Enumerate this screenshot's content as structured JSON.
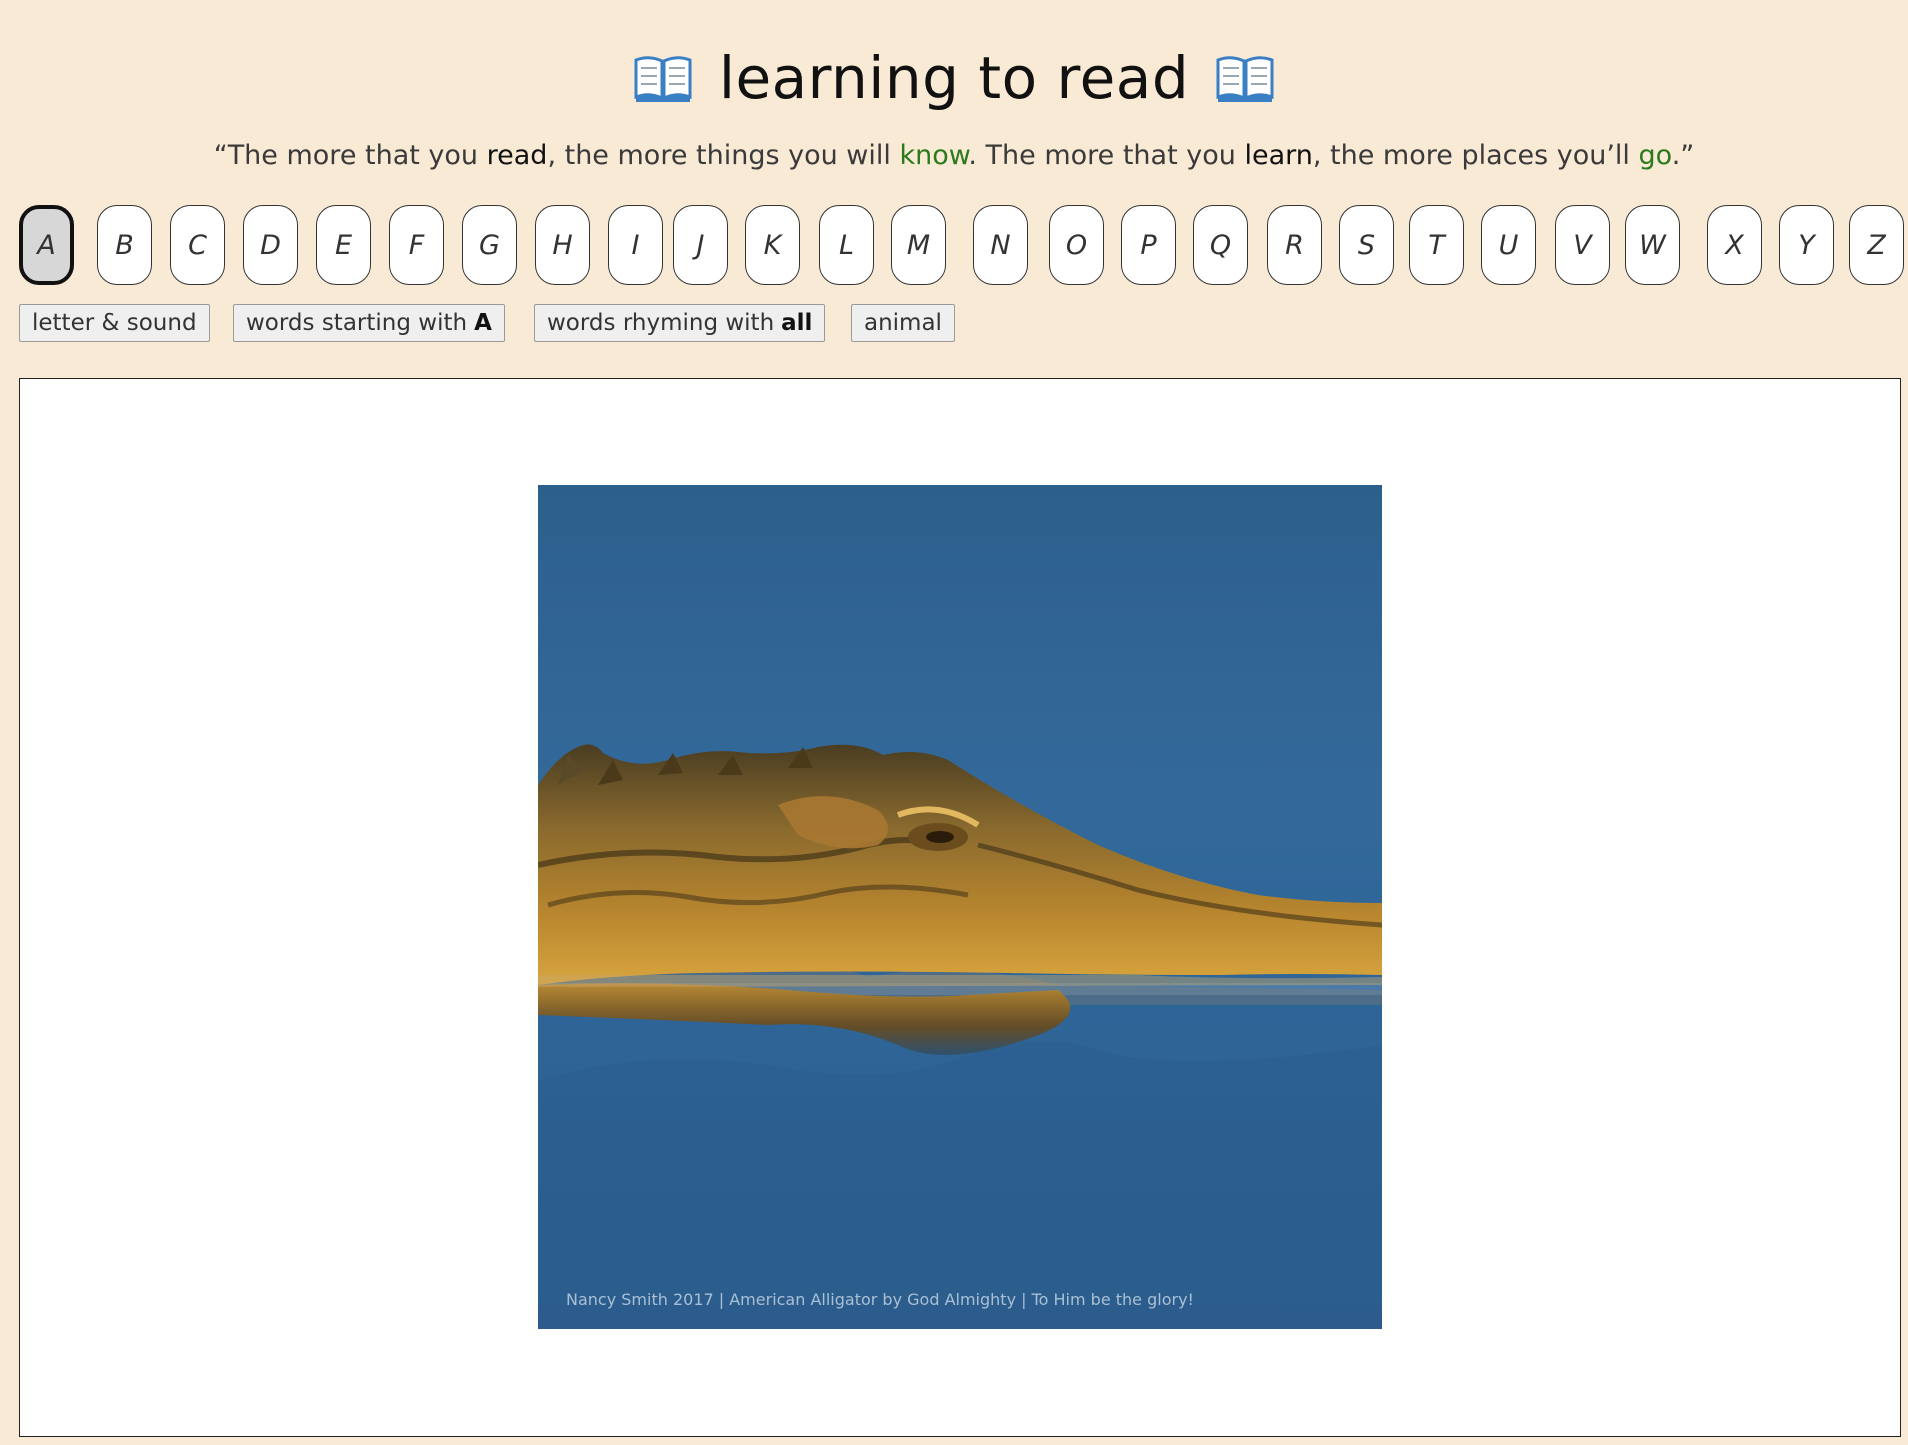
{
  "header": {
    "title": "learning to read",
    "icon": "open-book-icon"
  },
  "quote": {
    "open": "“The more that you ",
    "w1": "read",
    "t2": ", the more things you will ",
    "w2": "know",
    "t3": ". The more that you ",
    "w3": "learn",
    "t4": ", the more places you’ll ",
    "w4": "go",
    "close": ".”"
  },
  "alphabet": {
    "letters": [
      "A",
      "B",
      "C",
      "D",
      "E",
      "F",
      "G",
      "H",
      "I",
      "J",
      "K",
      "L",
      "M",
      "N",
      "O",
      "P",
      "Q",
      "R",
      "S",
      "T",
      "U",
      "V",
      "W",
      "X",
      "Y",
      "Z"
    ],
    "selected": "A"
  },
  "options": {
    "letter_sound": "letter & sound",
    "words_starting_prefix": "words starting with",
    "words_starting_value": "A",
    "words_rhyming_prefix": "words rhyming with",
    "words_rhyming_value": "all",
    "animal": "animal"
  },
  "display": {
    "image": "alligator-photo",
    "image_credit": "Nancy Smith 2017 | American Alligator by God Almighty | To Him be the glory!"
  },
  "colors": {
    "background": "#f9ead6",
    "accent_green": "#2c7a1b",
    "water_blue": "#2f6494",
    "alligator_gold": "#b8862e"
  }
}
